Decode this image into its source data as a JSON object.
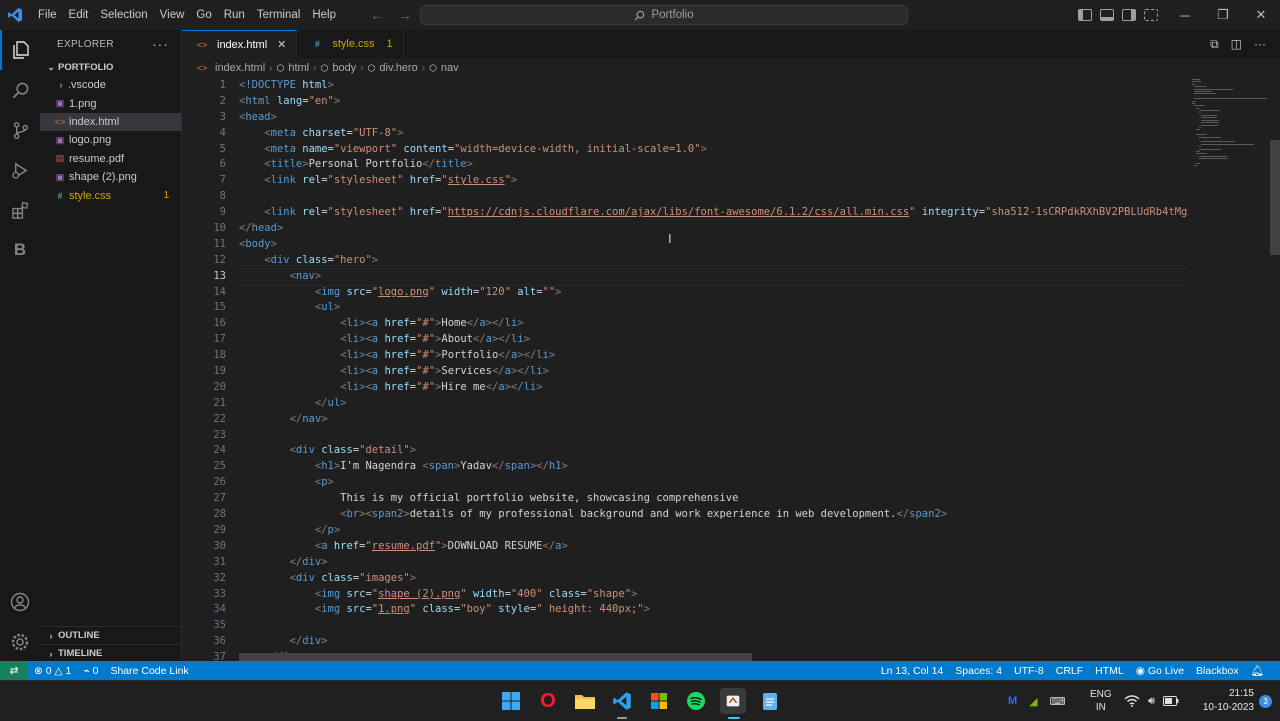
{
  "titlebar": {
    "menu": [
      "File",
      "Edit",
      "Selection",
      "View",
      "Go",
      "Run",
      "Terminal",
      "Help"
    ],
    "search_text": "Portfolio"
  },
  "sidebar": {
    "title": "EXPLORER",
    "folder": "PORTFOLIO",
    "files": [
      {
        "name": ".vscode",
        "kind": "folder"
      },
      {
        "name": "1.png",
        "kind": "img"
      },
      {
        "name": "index.html",
        "kind": "html"
      },
      {
        "name": "logo.png",
        "kind": "img"
      },
      {
        "name": "resume.pdf",
        "kind": "pdf"
      },
      {
        "name": "shape (2).png",
        "kind": "img"
      },
      {
        "name": "style.css",
        "kind": "css",
        "badge": "1"
      }
    ],
    "outline_label": "OUTLINE",
    "timeline_label": "TIMELINE"
  },
  "tabs": [
    {
      "label": "index.html",
      "icon": "<>"
    },
    {
      "label": "style.css",
      "icon": "#",
      "badge": "1"
    }
  ],
  "breadcrumb": [
    "index.html",
    "html",
    "body",
    "div.hero",
    "nav"
  ],
  "editor": {
    "current_line": 13,
    "line_numbers": [
      "1",
      "2",
      "3",
      "4",
      "5",
      "6",
      "7",
      "8",
      "9",
      "10",
      "11",
      "12",
      "13",
      "14",
      "15",
      "16",
      "17",
      "18",
      "19",
      "20",
      "21",
      "22",
      "23",
      "24",
      "25",
      "26",
      "27",
      "28",
      "29",
      "30",
      "31",
      "32",
      "33",
      "34",
      "35",
      "36",
      "37"
    ]
  },
  "status": {
    "errors": "0",
    "warnings": "1",
    "ports": "0",
    "share": "Share Code Link",
    "position": "Ln 13, Col 14",
    "spaces": "Spaces: 4",
    "encoding": "UTF-8",
    "eol": "CRLF",
    "language": "HTML",
    "golive": "Go Live",
    "blackbox": "Blackbox"
  },
  "taskbar": {
    "lang1": "ENG",
    "lang2": "IN",
    "time": "21:15",
    "date": "10-10-2023",
    "notifications": "3"
  },
  "colors": {
    "accent": "#007acc",
    "editor_bg": "#1f1f1f",
    "tag": "#569cd6",
    "attr": "#9cdcfe",
    "string": "#ce9178"
  }
}
